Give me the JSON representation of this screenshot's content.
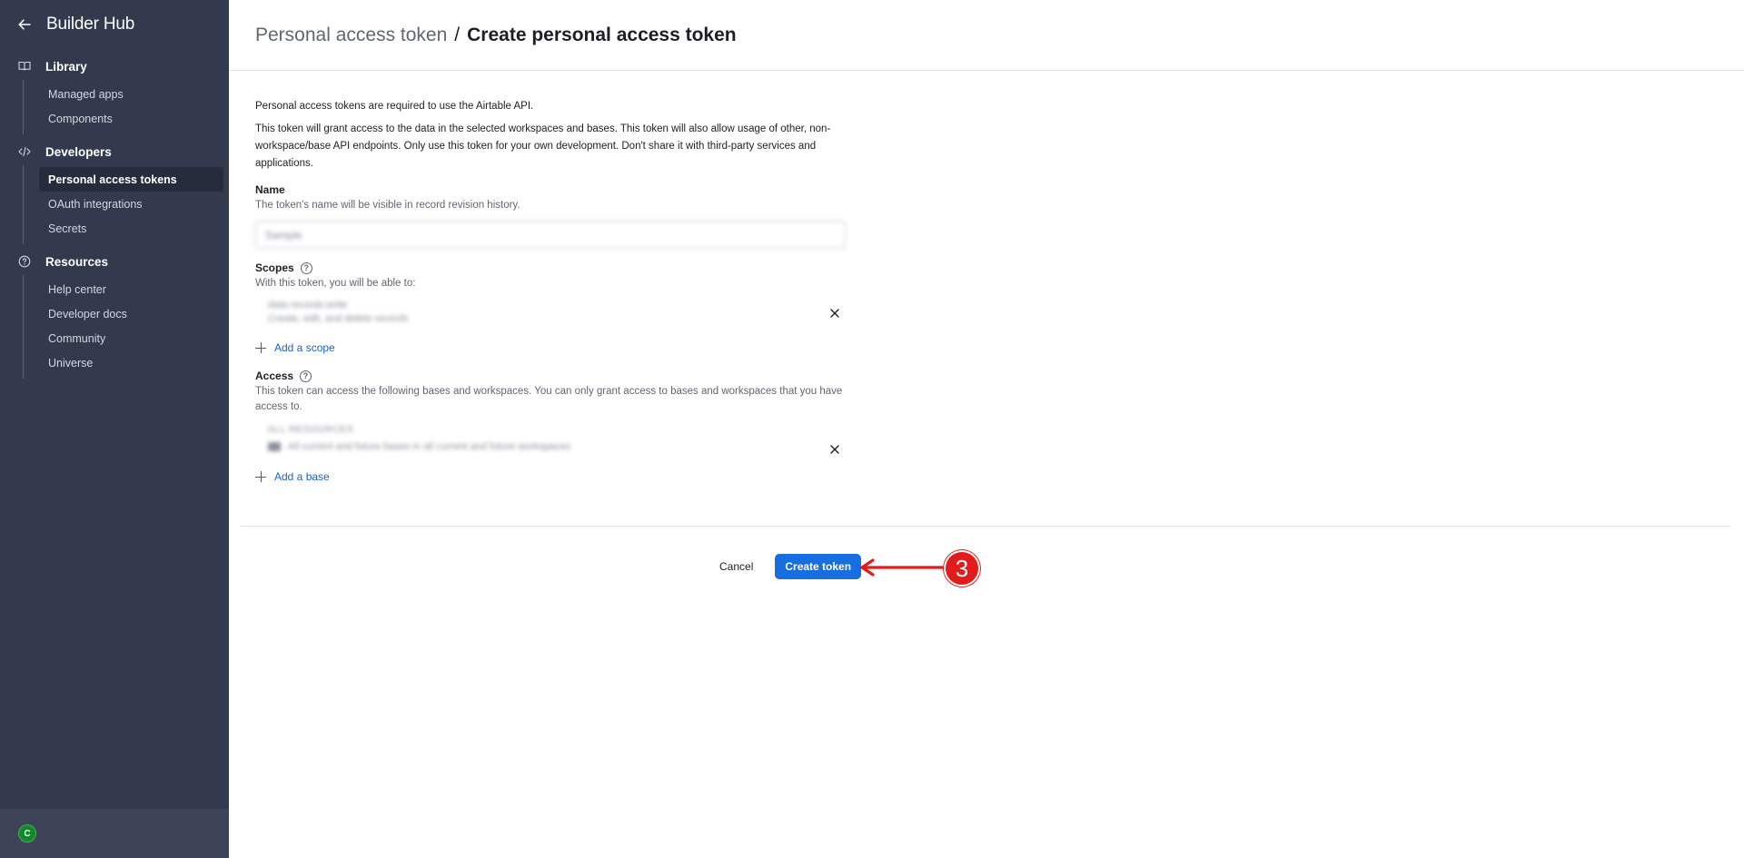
{
  "sidebar": {
    "title": "Builder Hub",
    "sections": [
      {
        "label": "Library",
        "icon": "book-icon",
        "items": [
          {
            "label": "Managed apps"
          },
          {
            "label": "Components"
          }
        ]
      },
      {
        "label": "Developers",
        "icon": "code-icon",
        "items": [
          {
            "label": "Personal access tokens",
            "active": true
          },
          {
            "label": "OAuth integrations"
          },
          {
            "label": "Secrets"
          }
        ]
      },
      {
        "label": "Resources",
        "icon": "help-circle-icon",
        "items": [
          {
            "label": "Help center"
          },
          {
            "label": "Developer docs"
          },
          {
            "label": "Community"
          },
          {
            "label": "Universe"
          }
        ]
      }
    ],
    "avatar_initial": "C"
  },
  "header": {
    "breadcrumb_parent": "Personal access token",
    "separator": "/",
    "title": "Create personal access token"
  },
  "form": {
    "intro_1": "Personal access tokens are required to use the Airtable API.",
    "intro_2": "This token will grant access to the data in the selected workspaces and bases. This token will also allow usage of other, non-workspace/base API endpoints. Only use this token for your own development. Don't share it with third-party services and applications.",
    "name_label": "Name",
    "name_help": "The token's name will be visible in record revision history.",
    "name_value": "Sample",
    "scopes_label": "Scopes",
    "scopes_help": "With this token, you will be able to:",
    "scope_1_name": "data.records:write",
    "scope_1_desc": "Create, edit, and delete records",
    "add_scope": "Add a scope",
    "access_label": "Access",
    "access_help": "This token can access the following bases and workspaces. You can only grant access to bases and workspaces that you have access to.",
    "access_1_title": "ALL RESOURCES",
    "access_1_desc": "All current and future bases in all current and future workspaces",
    "add_base": "Add a base"
  },
  "actions": {
    "cancel": "Cancel",
    "create": "Create token"
  },
  "annotation": {
    "step": "3",
    "color": "#e31b1b"
  },
  "colors": {
    "sidebar_bg": "#333a4d",
    "primary": "#166ee1",
    "link": "#1662d2"
  }
}
